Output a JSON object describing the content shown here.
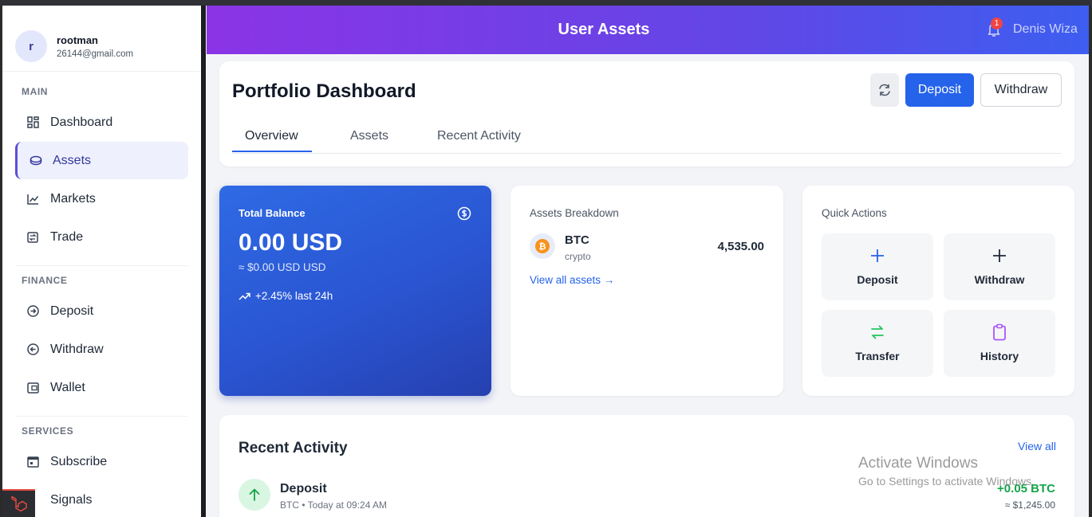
{
  "profile": {
    "initial": "r",
    "name": "rootman",
    "email": "26144@gmail.com"
  },
  "sidebar": {
    "sections": [
      {
        "label": "MAIN"
      },
      {
        "label": "FINANCE"
      },
      {
        "label": "SERVICES"
      }
    ],
    "items": [
      {
        "label": "Dashboard",
        "icon": "dashboard-icon"
      },
      {
        "label": "Assets",
        "icon": "coins-icon",
        "active": true
      },
      {
        "label": "Markets",
        "icon": "chart-line-icon"
      },
      {
        "label": "Trade",
        "icon": "exchange-icon"
      },
      {
        "label": "Deposit",
        "icon": "arrow-circle-right-icon"
      },
      {
        "label": "Withdraw",
        "icon": "arrow-circle-left-icon"
      },
      {
        "label": "Wallet",
        "icon": "wallet-icon"
      },
      {
        "label": "Subscribe",
        "icon": "calendar-icon"
      },
      {
        "label": "Signals",
        "icon": "signal-icon"
      }
    ]
  },
  "header": {
    "title": "User Assets",
    "notification_count": "1",
    "user_name": "Denis Wiza"
  },
  "dashboard": {
    "title": "Portfolio Dashboard",
    "deposit_label": "Deposit",
    "withdraw_label": "Withdraw",
    "tabs": [
      {
        "label": "Overview",
        "active": true
      },
      {
        "label": "Assets"
      },
      {
        "label": "Recent Activity"
      }
    ]
  },
  "balance": {
    "label": "Total Balance",
    "value": "0.00 USD",
    "sub": "≈ $0.00 USD USD",
    "change": "+2.45% last 24h"
  },
  "breakdown": {
    "label": "Assets Breakdown",
    "coin": {
      "symbol": "BTC",
      "type": "crypto",
      "amount": "4,535.00"
    },
    "view_all": "View all assets →"
  },
  "quick_actions": {
    "label": "Quick Actions",
    "items": [
      {
        "label": "Deposit",
        "icon": "plus-icon",
        "color": "#2563eb"
      },
      {
        "label": "Withdraw",
        "icon": "plus-icon",
        "color": "#1f2937"
      },
      {
        "label": "Transfer",
        "icon": "transfer-icon",
        "color": "#22c55e"
      },
      {
        "label": "History",
        "icon": "clipboard-icon",
        "color": "#a855f7"
      }
    ]
  },
  "activity": {
    "title": "Recent Activity",
    "view_all": "View all",
    "item": {
      "name": "Deposit",
      "sub": "BTC • Today at 09:24 AM",
      "amount": "+0.05 BTC",
      "usd": "≈ $1,245.00"
    }
  },
  "watermark": {
    "title": "Activate Windows",
    "sub": "Go to Settings to activate Windows."
  },
  "colors": {
    "accent": "#2563eb",
    "header_start": "#8b34e6",
    "header_end": "#3d5ef0",
    "positive": "#16a34a"
  }
}
